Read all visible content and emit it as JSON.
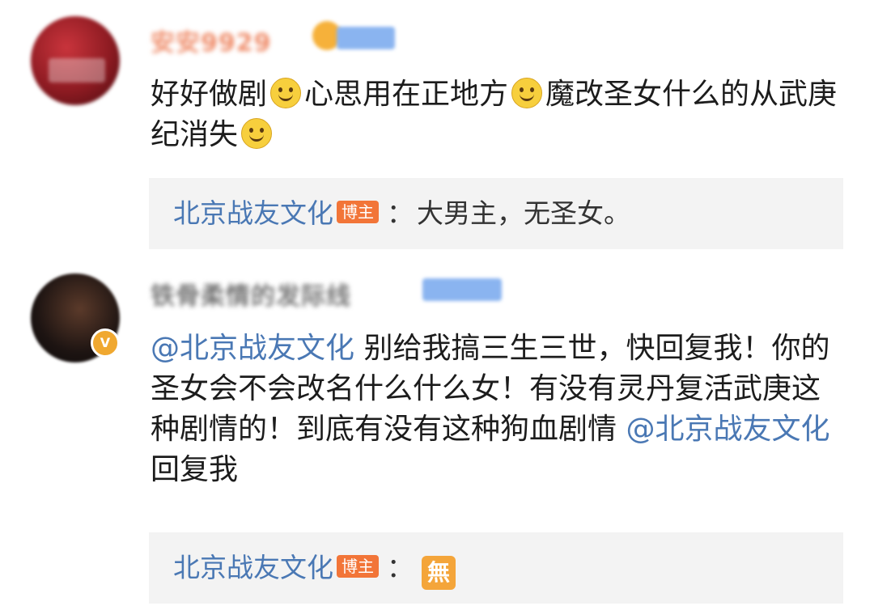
{
  "comments": [
    {
      "username": "安安9929",
      "text_parts": [
        "好好做剧",
        "心思用在正地方",
        "魔改圣女什么的从武庚纪消失"
      ],
      "emoji": "smile-emoji",
      "reply": {
        "author": "北京战友文化",
        "badge": "博主",
        "separator": "：",
        "text": "大男主，无圣女。"
      }
    },
    {
      "username": "铁骨柔情的发际线",
      "verified_badge": "V",
      "mention": "@北京战友文化",
      "text": " 别给我搞三生三世，快回复我！你的圣女会不会改名什么什么女！有没有灵丹复活武庚这种剧情的！到底有没有这种狗血剧情 ",
      "mention_end": "@北京战友文化",
      "text_end": " 回复我",
      "reply": {
        "author": "北京战友文化",
        "badge": "博主",
        "separator": "：",
        "sticker": "無"
      }
    }
  ],
  "colors": {
    "link": "#4a78b4",
    "host_badge": "#f27538",
    "reply_bg": "#f3f3f3"
  }
}
